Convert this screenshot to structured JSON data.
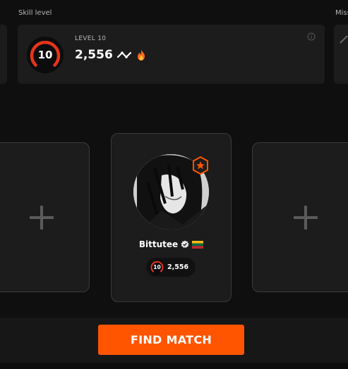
{
  "header": {
    "skill_label": "Skill level",
    "missions_label": "Miss"
  },
  "skill_panel": {
    "level_badge": "10",
    "level_text": "LEVEL 10",
    "elo": "2,556",
    "info_icon": "info-icon"
  },
  "player": {
    "name": "Bittutee",
    "level_badge": "10",
    "elo": "2,556",
    "verified_icon": "verified-icon",
    "flag": "lithuania-flag",
    "role_badge": "star-badge-icon"
  },
  "empty_slot_icon": "plus-icon",
  "actions": {
    "find_match_label": "FIND MATCH"
  },
  "colors": {
    "accent": "#ff5500",
    "level_red": "#e8331c",
    "background": "#0f0f0f",
    "panel": "#1c1c1c"
  }
}
